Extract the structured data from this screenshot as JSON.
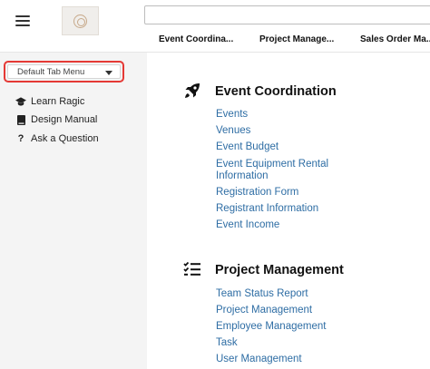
{
  "header": {
    "menu_icon": "hamburger-icon",
    "search_placeholder": "",
    "tabs": [
      {
        "label": "Event Coordina..."
      },
      {
        "label": "Project Manage..."
      },
      {
        "label": "Sales Order Ma..."
      }
    ]
  },
  "sidebar": {
    "tab_menu": {
      "label": "Default Tab Menu",
      "highlight_color": "#e53935"
    },
    "items": [
      {
        "label": "Learn Ragic",
        "icon": "graduation-cap-icon"
      },
      {
        "label": "Design Manual",
        "icon": "book-icon"
      },
      {
        "label": "Ask a Question",
        "icon": "question-icon"
      }
    ]
  },
  "main": {
    "sections": [
      {
        "title": "Event Coordination",
        "icon": "rocket-icon",
        "links": [
          "Events",
          "Venues",
          "Event Budget",
          "Event Equipment Rental",
          "Information",
          "Registration Form",
          "Registrant Information",
          "Event Income"
        ]
      },
      {
        "title": "Project Management",
        "icon": "task-list-icon",
        "links": [
          "Team Status Report",
          "Project Management",
          "Employee Management",
          "Task",
          "User Management"
        ]
      }
    ]
  },
  "colors": {
    "link": "#2e6da4",
    "sidebar_bg": "#f4f4f4"
  }
}
